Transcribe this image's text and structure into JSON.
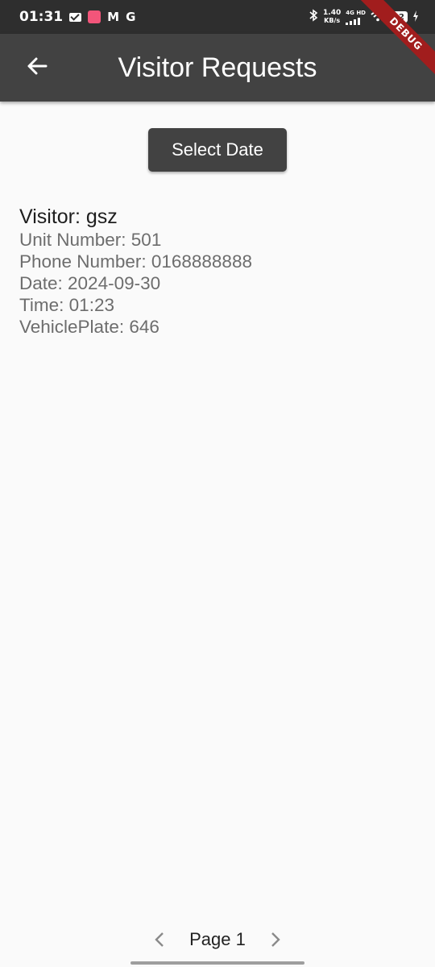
{
  "status_bar": {
    "time": "01:31",
    "app_icons": [
      "mail-icon",
      "app-icon",
      "gmail-icon",
      "google-icon"
    ],
    "gmail_letter": "M",
    "google_letter": "G",
    "network_speed_value": "1.40",
    "network_speed_unit": "KB/s",
    "network_type": "4G HD",
    "battery_level": "22"
  },
  "debug_banner": "DEBUG",
  "app_bar": {
    "title": "Visitor Requests",
    "back_icon": "arrow-left-icon"
  },
  "select_date_label": "Select Date",
  "visitor": {
    "name": "Visitor: gsz",
    "unit": "Unit Number: 501",
    "phone": "Phone Number: 0168888888",
    "date": "Date: 2024-09-30",
    "time": "Time: 01:23",
    "vehicle_plate": "VehiclePlate: 646"
  },
  "pagination": {
    "label": "Page 1"
  },
  "colors": {
    "app_bar": "#424242",
    "status_bar": "#2e2e2e",
    "background": "#fafafa",
    "debug_banner": "#a11d1d"
  }
}
